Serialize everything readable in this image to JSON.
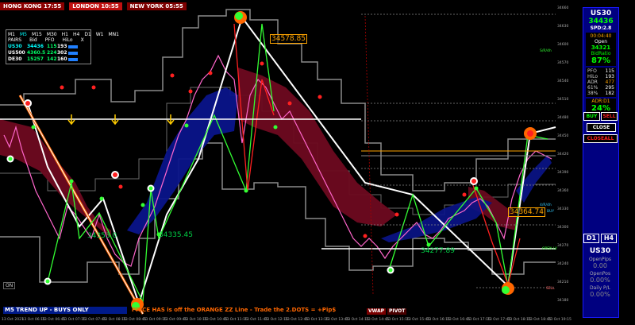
{
  "sessions": {
    "hong_kong": "HONG KONG 17:55",
    "london": "LONDON  10:55",
    "new_york": "NEW YORK 05:55"
  },
  "symbol_table": {
    "headers": [
      "M1",
      "M5",
      "M15",
      "M30",
      "H1",
      "H4",
      "D1",
      "W1",
      "MN1"
    ],
    "subheaders": [
      "PAIRS",
      "Bid",
      "PFO",
      "HiLo",
      "X"
    ],
    "rows": [
      {
        "symbol": "US30",
        "bid": "34436",
        "pfo": "115",
        "hilo": "193",
        "color": "#00ffff"
      },
      {
        "symbol": "US500",
        "bid": "4360.5",
        "pfo": "224",
        "hilo": "302",
        "color": "#ffffff"
      },
      {
        "symbol": "DE30",
        "bid": "15257",
        "pfo": "142",
        "hilo": "160",
        "color": "#ffffff"
      }
    ]
  },
  "right_panel": {
    "symbol": "US30",
    "bid": "34436",
    "spread": "SPD:2.8",
    "timer": "00:04:40",
    "open_label": "Open",
    "open_value": "34321",
    "bid_ratio_label": "BidRatio",
    "bid_ratio": "87%",
    "stats": [
      {
        "k": "PFO",
        "v": "115"
      },
      {
        "k": "HiLo",
        "v": "193"
      },
      {
        "k": "ADR",
        "v": "477"
      },
      {
        "k": "61%",
        "v": "295"
      },
      {
        "k": "38%",
        "v": "182"
      }
    ],
    "adr_label": "ADR:D1",
    "adr_pct": "24%",
    "buttons": {
      "buy": "BUY",
      "sell": "SELL",
      "close": "CLOSE",
      "closeall": "CLOSEALL",
      "d1": "D1",
      "h4": "H4"
    },
    "lower_symbol": "US30",
    "open_pips_label": "OpenPips",
    "open_pips": "0.00",
    "open_pos_label": "OpenPos",
    "open_pos": "0.00%",
    "daily_pl_label": "Daily P/L",
    "daily_pl": "0.00%"
  },
  "status_text": "M5 TREND UP - BUYS ONLY",
  "alert_text": "PRICE HAS is off the ORANGE ZZ Line - Trade the 2.DOTS = +Pip$",
  "tags": {
    "vwap": "VWAP",
    "pivot": "PIVOT"
  },
  "on_label": "ON",
  "price_labels": {
    "top": "34578.85",
    "right": "34364.74",
    "left1": "34353.0",
    "left2": "34335.45",
    "mid": "34277.89"
  },
  "level_labels": {
    "s_h": "S/R/4h",
    "r_h": "4/R/4h",
    "buy": "BUY",
    "open": "OPEN LV",
    "sell": "SELL"
  },
  "y_axis": [
    "34660",
    "34630",
    "34600",
    "34570",
    "34540",
    "34510",
    "34480",
    "34450",
    "34420",
    "34390",
    "34360",
    "34330",
    "34300",
    "34270",
    "34240",
    "34210",
    "34180"
  ],
  "x_axis": [
    "13 Oct 2021",
    "13 Oct 06:15",
    "13 Oct 06:45",
    "13 Oct 07:15",
    "13 Oct 07:45",
    "13 Oct 08:15",
    "13 Oct 08:45",
    "13 Oct 09:15",
    "13 Oct 09:45",
    "13 Oct 10:15",
    "13 Oct 10:45",
    "13 Oct 11:15",
    "13 Oct 11:45",
    "13 Oct 12:15",
    "13 Oct 12:45",
    "13 Oct 13:15",
    "13 Oct 13:45",
    "13 Oct 14:15",
    "13 Oct 14:45",
    "13 Oct 15:15",
    "13 Oct 15:45",
    "13 Oct 16:15",
    "13 Oct 16:45",
    "13 Oct 17:15",
    "13 Oct 17:45",
    "13 Oct 18:15",
    "13 Oct 18:45",
    "13 Oct 19:15"
  ],
  "colors": {
    "background": "#000000",
    "bull_band": "#0a1a8a",
    "bear_band": "#7a0020",
    "zigzag": "#ffffff",
    "orange_line": "#ff6600",
    "green_line": "#00ff00"
  }
}
